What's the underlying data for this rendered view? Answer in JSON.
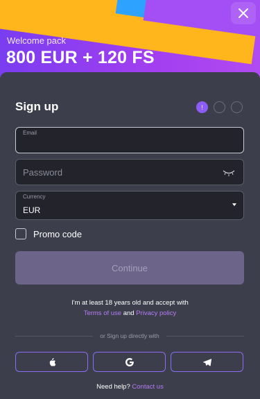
{
  "banner": {
    "subtitle": "Welcome pack",
    "title": "800 EUR + 120 FS"
  },
  "signup": {
    "title": "Sign up",
    "steps": [
      "!",
      "",
      ""
    ]
  },
  "fields": {
    "email_label": "Email",
    "email_value": "",
    "password_placeholder": "Password",
    "currency_label": "Currency",
    "currency_value": "EUR"
  },
  "promo": {
    "label": "Promo code"
  },
  "continue": {
    "label": "Continue"
  },
  "legal": {
    "line1": "I'm at least 18 years old and accept with",
    "terms": "Terms of use",
    "and": "and",
    "privacy": "Privacy policy"
  },
  "divider": {
    "text": "or Sign up directly with"
  },
  "social": [
    "apple-icon",
    "google-icon",
    "telegram-icon"
  ],
  "help": {
    "text": "Need help?",
    "link": "Contact us"
  },
  "colors": {
    "accent": "#8b5cf6",
    "link": "#b47cf5",
    "background": "#3c3e4b"
  }
}
